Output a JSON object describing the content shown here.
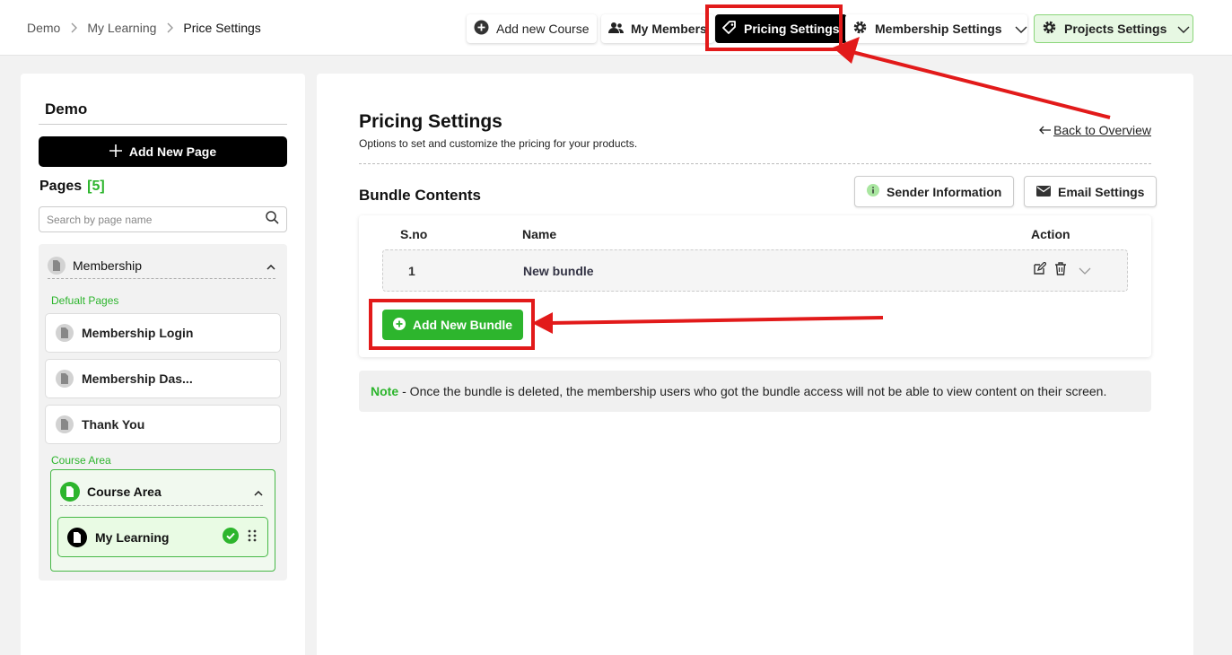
{
  "breadcrumb": [
    "Demo",
    "My Learning",
    "Price Settings"
  ],
  "topnav": {
    "add_course": "Add new Course",
    "members": "My Members",
    "pricing": "Pricing Settings",
    "membership_settings": "Membership Settings",
    "projects_settings": "Projects Settings"
  },
  "sidebar": {
    "title": "Demo",
    "add_page": "Add New Page",
    "pages_label": "Pages",
    "pages_count": "[5]",
    "search_placeholder": "Search by page name",
    "membership_group": "Membership",
    "default_label": "Defualt Pages",
    "default_pages": [
      "Membership Login",
      "Membership Das...",
      "Thank You"
    ],
    "course_label": "Course Area",
    "course_group": "Course Area",
    "course_item": "My Learning"
  },
  "main": {
    "title": "Pricing Settings",
    "subtitle": "Options to set and customize the pricing for your products.",
    "back": "Back to Overview",
    "bundle_heading": "Bundle Contents",
    "sender_info": "Sender Information",
    "email_settings": "Email Settings",
    "columns": {
      "sno": "S.no",
      "name": "Name",
      "action": "Action"
    },
    "rows": [
      {
        "sno": "1",
        "name": "New bundle"
      }
    ],
    "add_bundle": "Add New Bundle",
    "note_label": "Note",
    "note_text": "- Once the bundle is deleted, the membership users who got the bundle access will not be able to view content on their screen."
  },
  "colors": {
    "accent_green": "#2db52d",
    "annotation_red": "#e21a1a"
  }
}
